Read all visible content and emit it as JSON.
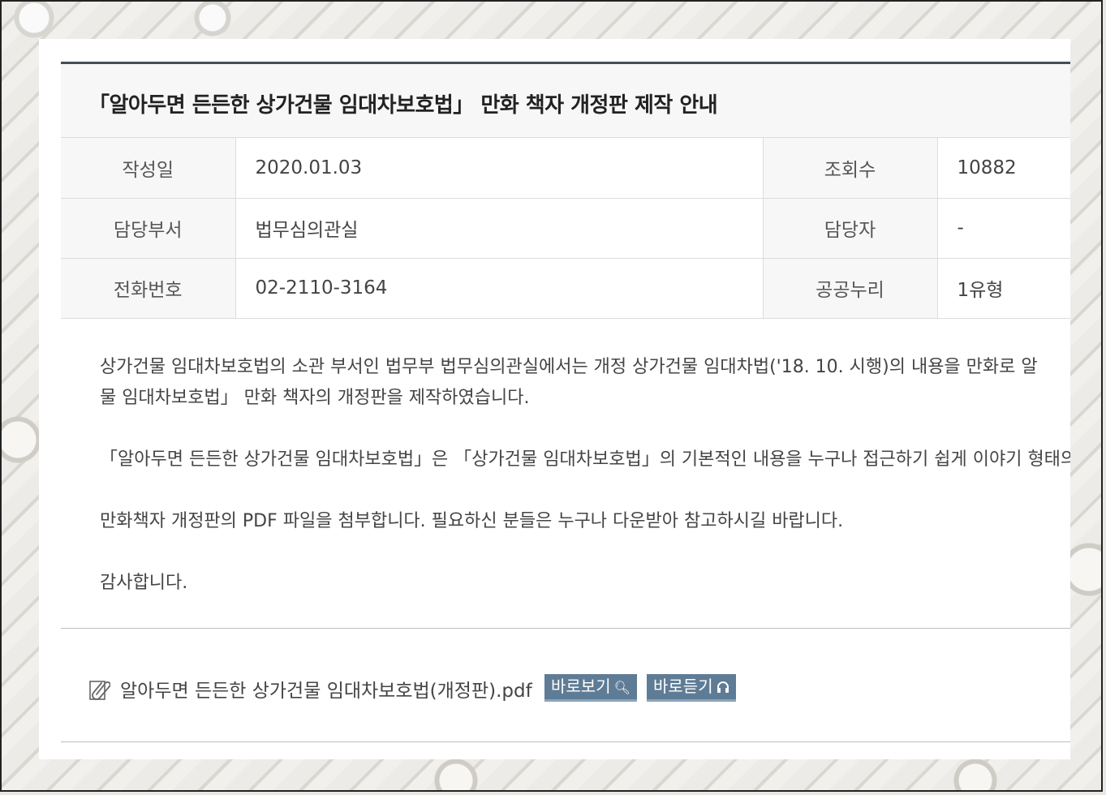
{
  "post": {
    "title": "「알아두면 든든한 상가건물 임대차보호법」 만화 책자 개정판 제작 안내"
  },
  "info": {
    "date_label": "작성일",
    "date_value": "2020.01.03",
    "views_label": "조회수",
    "views_value": "10882",
    "dept_label": "담당부서",
    "dept_value": "법무심의관실",
    "manager_label": "담당자",
    "manager_value": "-",
    "phone_label": "전화번호",
    "phone_value": "02-2110-3164",
    "license_label": "공공누리",
    "license_value": "1유형"
  },
  "content": {
    "p1_line1": "상가건물 임대차보호법의 소관 부서인 법무부 법무심의관실에서는 개정 상가건물 임대차법('18. 10. 시행)의 내용을 만화로 알",
    "p1_line2": "물 임대차보호법」 만화 책자의 개정판을 제작하였습니다.",
    "p2": "「알아두면 든든한 상가건물 임대차보호법」은 「상가건물 임대차보호법」의 기본적인 내용을 누구나 접근하기 쉽게 이야기 형태의",
    "p3": "만화책자 개정판의 PDF 파일을 첨부합니다. 필요하신 분들은 누구나 다운받아 참고하시길 바랍니다.",
    "p4": "감사합니다."
  },
  "attachment": {
    "icon": "paperclip-icon",
    "file_name": "알아두면 든든한 상가건물 임대차보호법(개정판).pdf",
    "view_button": "바로보기",
    "view_icon": "search-icon",
    "listen_button": "바로듣기",
    "listen_icon": "headphones-icon"
  },
  "colors": {
    "button_bg": "#5f7c96",
    "title_border": "#444c57"
  }
}
